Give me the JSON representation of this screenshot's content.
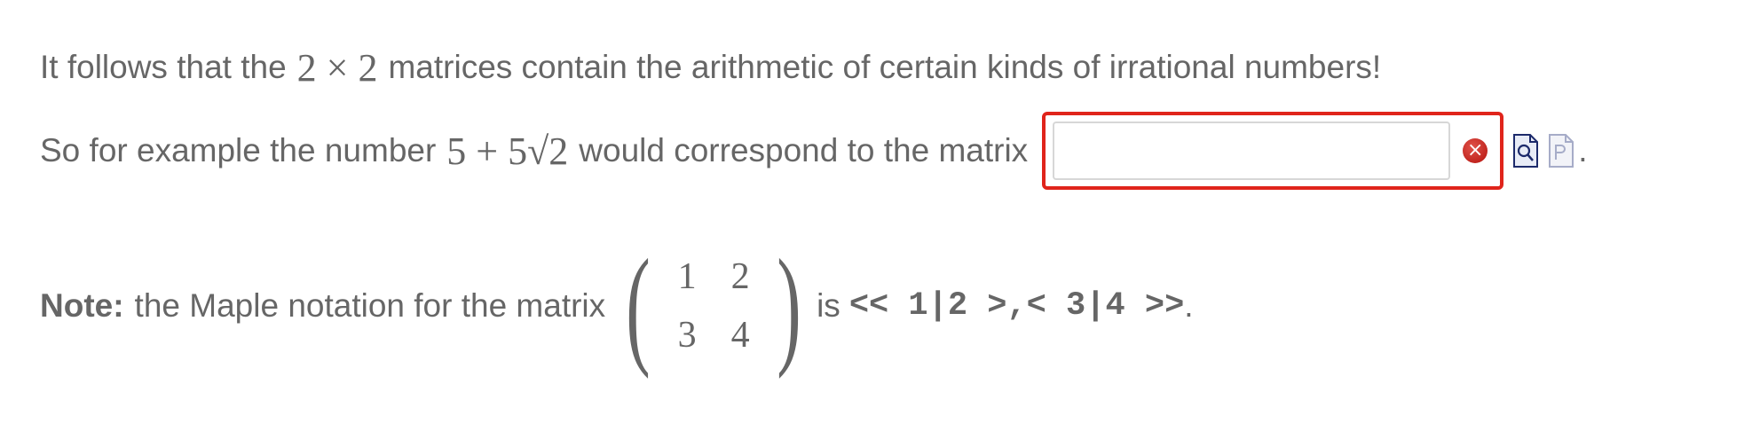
{
  "line1": {
    "before": "It follows that the",
    "math": "2 × 2",
    "after": "matrices contain the arithmetic of certain kinds of irrational numbers!"
  },
  "line2": {
    "before": "So for example the number",
    "math": "5 + 5√2",
    "after": "would correspond to the matrix",
    "answer_value": "",
    "trailing": "."
  },
  "icons": {
    "error": "error-icon",
    "preview": "preview-document-icon",
    "plot": "plot-document-icon"
  },
  "note": {
    "label": "Note:",
    "text": "the Maple notation for the matrix",
    "matrix": [
      [
        "1",
        "2"
      ],
      [
        "3",
        "4"
      ]
    ],
    "is": "is",
    "maple": "<< 1|2 >,< 3|4 >>",
    "end": "."
  },
  "colors": {
    "text": "#666666",
    "error_border": "#e0241b",
    "error_icon": "#c41a12"
  }
}
